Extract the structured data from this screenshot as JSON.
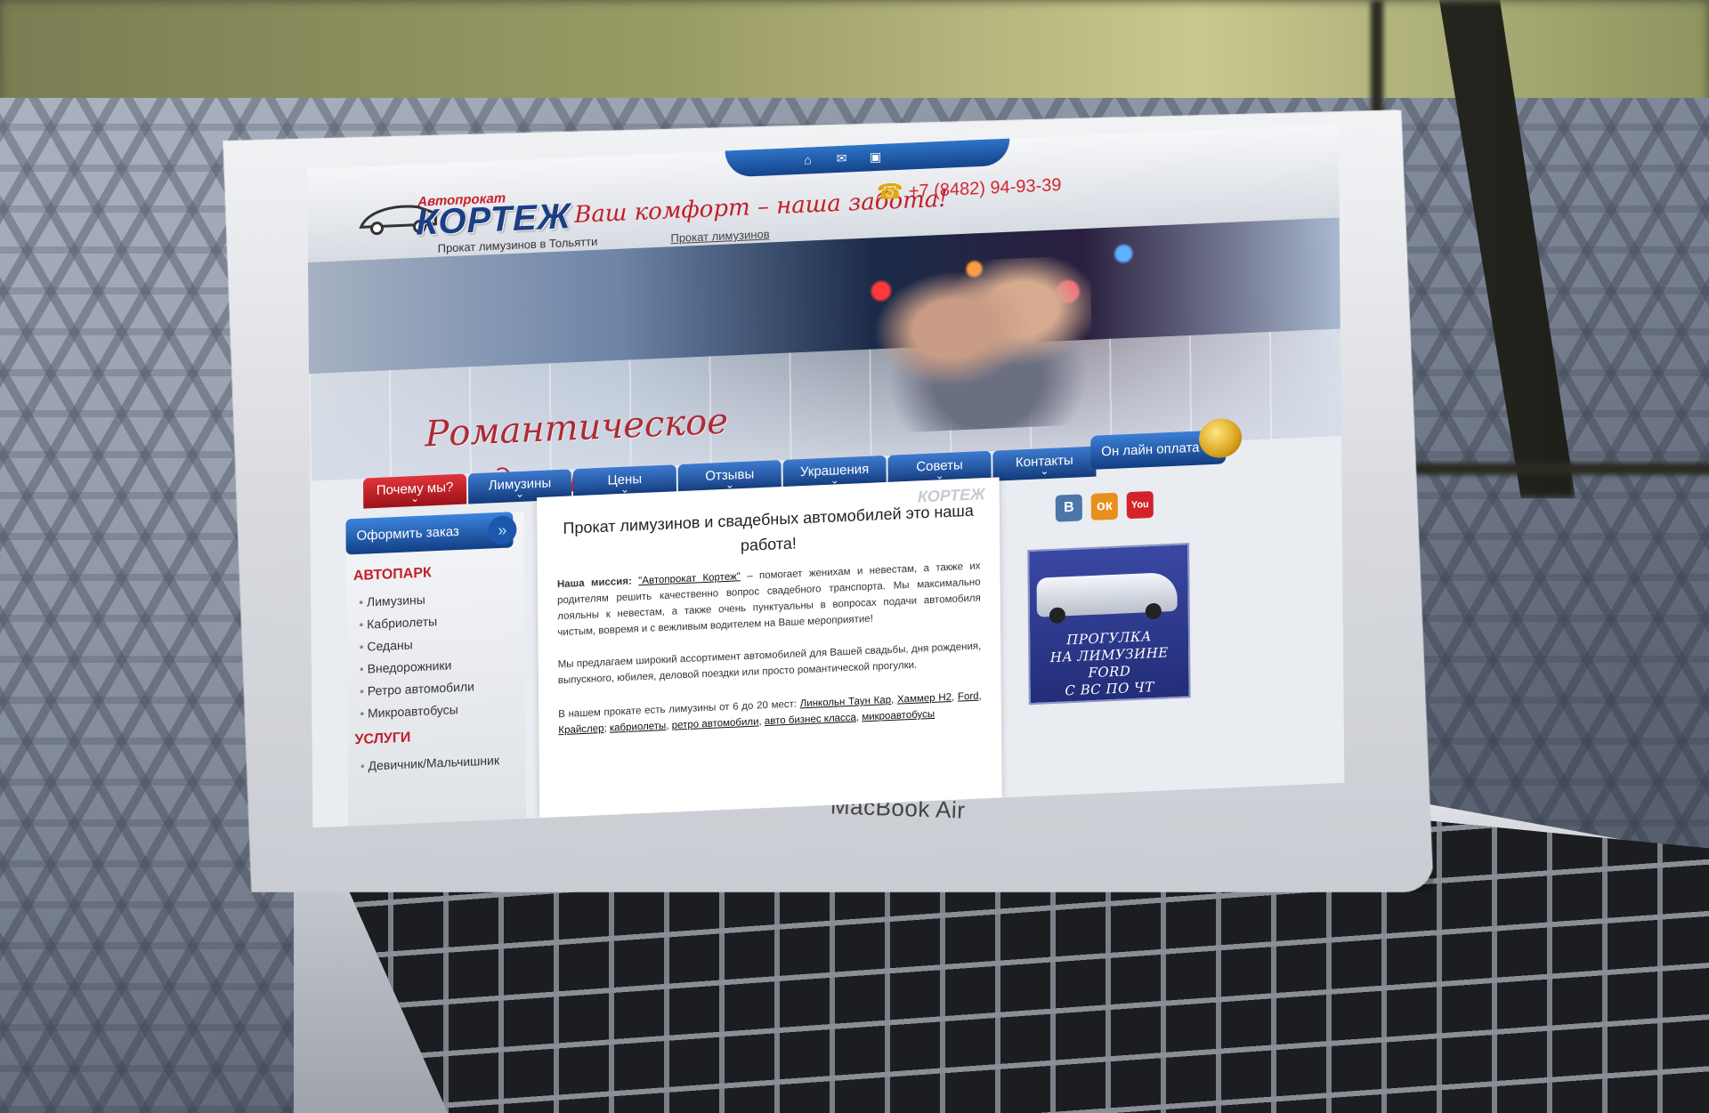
{
  "laptop": {
    "brand": "MacBook Air"
  },
  "site": {
    "logo_small": "Автопрокат",
    "logo_big": "КОРТЕЖ",
    "logo_subtitle": "Прокат лимузинов в Тольятти",
    "slogan": "Ваш комфорт – наша забота!",
    "slogan_link": "Прокат лимузинов",
    "phone": "+7 (8482) 94-93-39",
    "banner_text_line1": "Романтическое",
    "banner_text_line2": "свидание"
  },
  "nav": {
    "items": [
      {
        "label": "Почему мы?",
        "active": true
      },
      {
        "label": "Лимузины"
      },
      {
        "label": "Цены"
      },
      {
        "label": "Отзывы"
      },
      {
        "label": "Украшения"
      },
      {
        "label": "Советы"
      },
      {
        "label": "Контакты"
      }
    ],
    "pay_label": "Он лайн оплата"
  },
  "sidebar": {
    "order_label": "Оформить заказ",
    "heading_autopark": "АВТОПАРК",
    "autopark": [
      "Лимузины",
      "Кабриолеты",
      "Седаны",
      "Внедорожники",
      "Ретро автомобили",
      "Микроавтобусы"
    ],
    "heading_services": "УСЛУГИ",
    "services": [
      "Девичник/Мальчишник"
    ]
  },
  "content": {
    "watermark": "КОРТЕЖ",
    "title": "Прокат лимузинов и свадебных автомобилей это наша работа!",
    "p1_lead": "Наша миссия:",
    "p1_link": "\"Автопрокат Кортеж\"",
    "p1_text": " – помогает женихам и невестам, а также их родителям решить качественно вопрос свадебного транспорта. Мы максимально лояльны к невестам, а также очень пунктуальны в вопросах подачи автомобиля чистым, вовремя и с вежливым водителем на Ваше мероприятие!",
    "p2_text": "Мы предлагаем широкий ассортимент автомобилей для Вашей свадьбы, дня рождения, выпускного, юбилея, деловой поездки или просто романтической прогулки.",
    "p3_text": "В нашем прокате есть лимузины от 6 до 20 мест:",
    "p3_links": [
      "Линкольн Таун Кар",
      "Хаммер Н2",
      "Ford",
      "Крайслер"
    ],
    "p3_tail_links": [
      "кабриолеты",
      "ретро автомобили",
      "авто бизнес класса",
      "микроавтобусы"
    ]
  },
  "rightcol": {
    "social": [
      {
        "icon": "vk-icon",
        "glyph": "В",
        "color": "#4a76a8"
      },
      {
        "icon": "ok-icon",
        "glyph": "ок",
        "color": "#e88e1a"
      },
      {
        "icon": "youtube-icon",
        "glyph": "You",
        "color": "#d3222a"
      }
    ],
    "promo_lines": [
      "ПРОГУЛКА",
      "НА ЛИМУЗИНЕ",
      "FORD",
      "С ВС ПО ЧТ"
    ]
  }
}
